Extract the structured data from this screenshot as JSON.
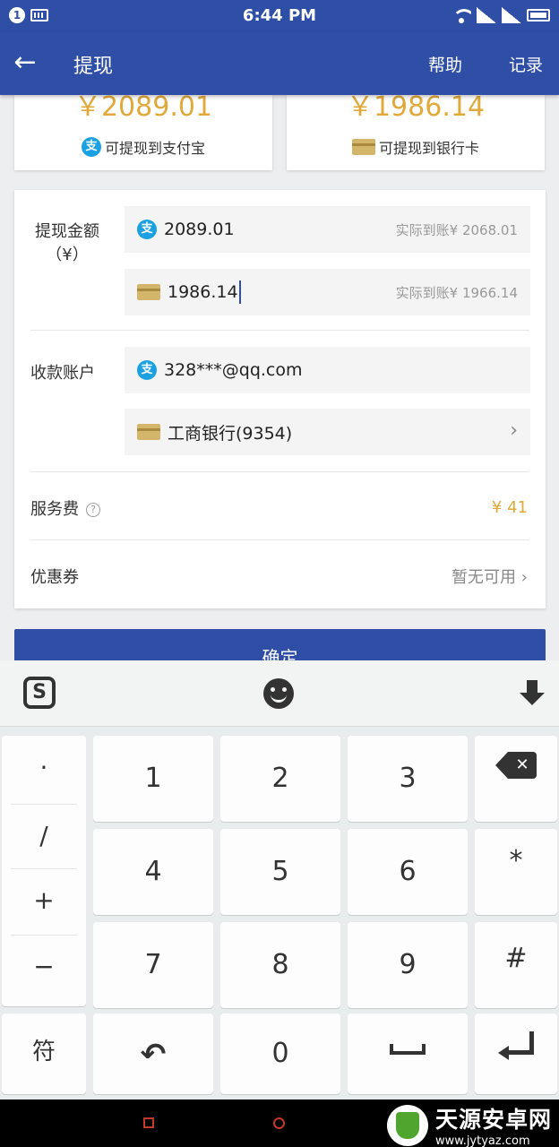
{
  "status_bar": {
    "notification_count": "1",
    "time": "6:44 PM"
  },
  "header": {
    "title": "提现",
    "help_label": "帮助",
    "records_label": "记录"
  },
  "balances": {
    "alipay": {
      "amount": "￥2089.01",
      "label": "可提现到支付宝",
      "icon": "alipay-icon"
    },
    "bank": {
      "amount": "￥1986.14",
      "label": "可提现到银行卡",
      "icon": "bank-card-icon"
    }
  },
  "form": {
    "amount_label": "提现金额",
    "amount_unit": "（¥）",
    "alipay_amount": "2089.01",
    "alipay_actual": "实际到账¥ 2068.01",
    "bank_amount": "1986.14",
    "bank_actual": "实际到账¥ 1966.14",
    "account_label": "收款账户",
    "alipay_account": "328***@qq.com",
    "bank_account": "工商银行(9354)",
    "fee_label": "服务费",
    "fee_value": "¥ 41",
    "coupon_label": "优惠券",
    "coupon_value": "暂无可用",
    "confirm_label": "确定"
  },
  "keyboard": {
    "side_keys": [
      "·",
      "/",
      "+",
      "−"
    ],
    "symbol_key": "符",
    "digits": [
      "1",
      "2",
      "3",
      "4",
      "5",
      "6",
      "7",
      "8",
      "9",
      "0"
    ],
    "star": "*",
    "hash": "#"
  },
  "watermark": {
    "title": "天源安卓网",
    "url": "www.jytyaz.com"
  },
  "colors": {
    "primary": "#2f4fa6",
    "accent_gold": "#e0a93a",
    "alipay_blue": "#1ba1e2"
  }
}
